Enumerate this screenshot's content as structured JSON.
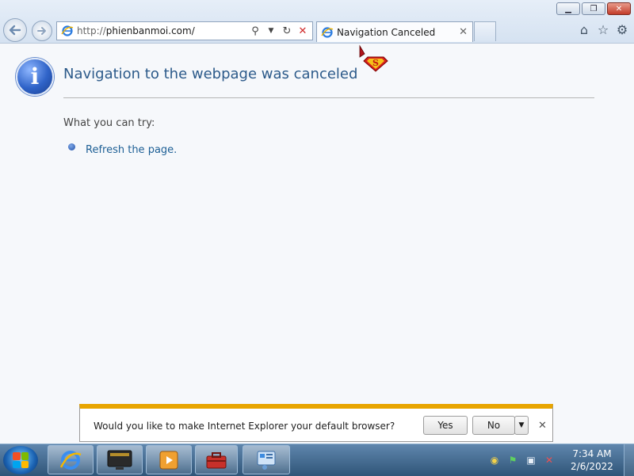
{
  "browser": {
    "address_protocol": "http://",
    "address_host": "phienbanmoi.com/",
    "tab_title": "Navigation Canceled"
  },
  "page": {
    "heading": "Navigation to the webpage was canceled",
    "try_heading": "What you can try:",
    "refresh_link": "Refresh the page."
  },
  "notification": {
    "message": "Would you like to make Internet Explorer your default browser?",
    "yes_label": "Yes",
    "no_label": "No"
  },
  "taskbar": {
    "time": "7:34 AM",
    "date": "2/6/2022",
    "pinned": [
      "internet-explorer",
      "movie-app",
      "media-player",
      "toolbox",
      "control-panel"
    ]
  },
  "colors": {
    "heading": "#2c5a8a",
    "link": "#1d5f95",
    "notification_accent": "#e8a500",
    "taskbar": "#3d6590"
  }
}
